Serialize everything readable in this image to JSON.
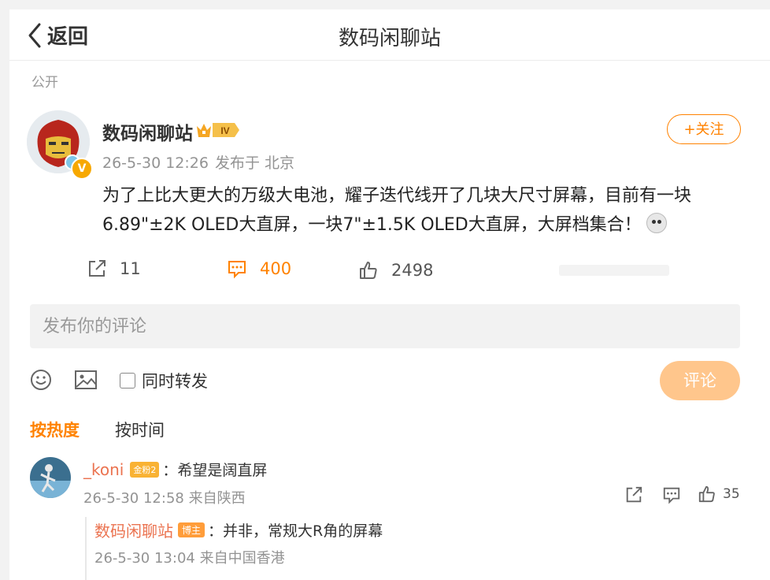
{
  "header": {
    "back_label": "返回",
    "title": "数码闲聊站"
  },
  "visibility": "公开",
  "post": {
    "author": "数码闲聊站",
    "level_badge": "IV",
    "time": "26-5-30 12:26",
    "location": "发布于 北京",
    "follow_label": "+关注",
    "line1": "为了上比大更大的万级大电池，耀子迭代线开了几块大尺寸屏幕，目前有一块",
    "line2": "6.89\"±2K OLED大直屏，一块7\"±1.5K OLED大直屏，大屏档集合！",
    "shares": "11",
    "comments": "400",
    "likes": "2498"
  },
  "composer": {
    "placeholder": "发布你的评论",
    "repost_label": "同时转发",
    "submit_label": "评论"
  },
  "sort": {
    "hot": "按热度",
    "time": "按时间"
  },
  "comment": {
    "user": "_koni",
    "badge": "金粉2",
    "text": "：希望是阔直屏",
    "time": "26-5-30 12:58",
    "location": "来自陕西",
    "likes": "35"
  },
  "reply": {
    "user": "数码闲聊站",
    "badge": "博主",
    "text": "：并非，常规大R角的屏幕",
    "time": "26-5-30 13:04",
    "location": "来自中国香港"
  },
  "colors": {
    "accent": "#ff8200",
    "username": "#eb7350",
    "meta": "#939393"
  }
}
